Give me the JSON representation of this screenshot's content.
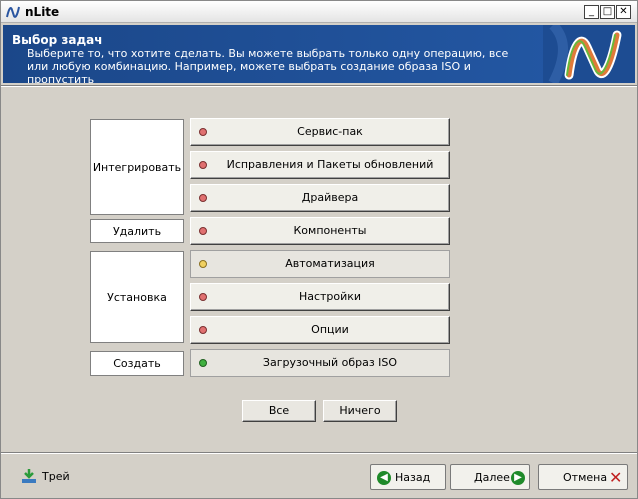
{
  "window": {
    "title": "nLite"
  },
  "header": {
    "title": "Выбор задач",
    "description": "Выберите то, что хотите сделать. Вы можете выбрать только одну операцию, все или любую комбинацию. Например, можете выбрать создание образа ISO и пропустить"
  },
  "categories": {
    "integrate": "Интегрировать",
    "remove": "Удалить",
    "setup": "Установка",
    "create": "Создать"
  },
  "tasks": [
    {
      "label": "Сервис-пак",
      "status": "red"
    },
    {
      "label": "Исправления и Пакеты обновлений",
      "status": "red"
    },
    {
      "label": "Драйвера",
      "status": "red"
    },
    {
      "label": "Компоненты",
      "status": "red"
    },
    {
      "label": "Автоматизация",
      "status": "yellow"
    },
    {
      "label": "Настройки",
      "status": "red"
    },
    {
      "label": "Опции",
      "status": "red"
    },
    {
      "label": "Загрузочный образ ISO",
      "status": "green"
    }
  ],
  "selection": {
    "all": "Все",
    "none": "Ничего"
  },
  "footer": {
    "tray": "Трей",
    "back": "Назад",
    "next": "Далее",
    "cancel": "Отмена"
  },
  "colors": {
    "red": "#e07070",
    "yellow": "#f0d060",
    "green": "#40b040",
    "header_bg": "#1e4e8f"
  }
}
